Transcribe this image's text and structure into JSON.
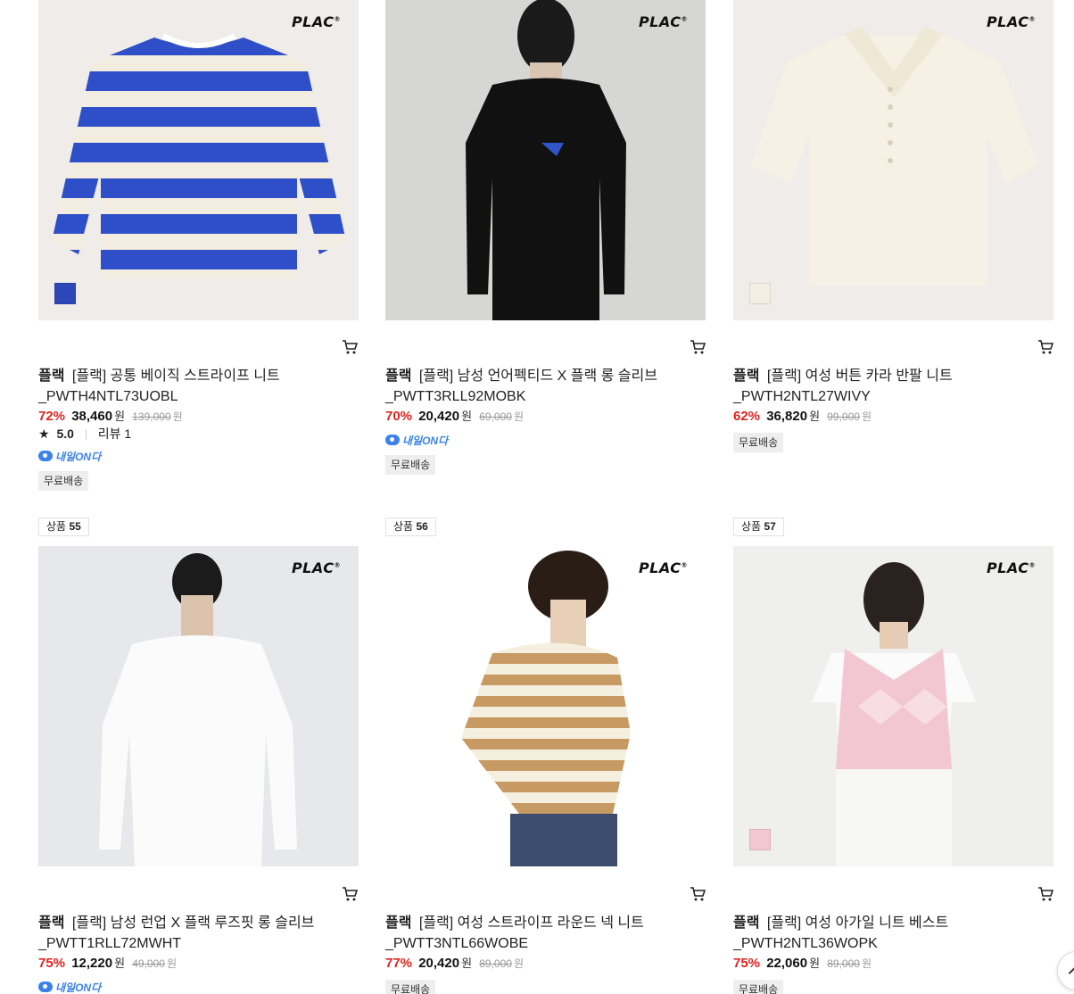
{
  "products": [
    {
      "brand": "플랙",
      "name": "[플랙] 공통 베이직 스트라이프 니트",
      "code": "_PWTH4NTL73UOBL",
      "discount": "72%",
      "price": "38,460",
      "currency": "원",
      "original_price": "139,000",
      "rating": "5.0",
      "reviews": "리뷰 1",
      "tomorrow_label": "내일ON다",
      "tag": "무료배송",
      "logo": "PLAC",
      "swatch_color": "#2d47b8"
    },
    {
      "brand": "플랙",
      "name": "[플랙] 남성 언어펙티드 X 플랙 롱 슬리브",
      "code": "_PWTT3RLL92MOBK",
      "discount": "70%",
      "price": "20,420",
      "currency": "원",
      "original_price": "69,000",
      "tomorrow_label": "내일ON다",
      "tag": "무료배송",
      "logo": "PLAC"
    },
    {
      "brand": "플랙",
      "name": "[플랙] 여성 버튼 카라 반팔 니트",
      "code": "_PWTH2NTL27WIVY",
      "discount": "62%",
      "price": "36,820",
      "currency": "원",
      "original_price": "99,000",
      "tag": "무료배송",
      "logo": "PLAC",
      "swatch_color": "#f3efe3"
    },
    {
      "rank_label": "상품",
      "rank_number": "55",
      "brand": "플랙",
      "name": "[플랙] 남성 런업 X 플랙 루즈핏 롱 슬리브",
      "code": "_PWTT1RLL72MWHT",
      "discount": "75%",
      "price": "12,220",
      "currency": "원",
      "original_price": "49,000",
      "tomorrow_label": "내일ON다",
      "logo": "PLAC"
    },
    {
      "rank_label": "상품",
      "rank_number": "56",
      "brand": "플랙",
      "name": "[플랙] 여성 스트라이프 라운드 넥 니트",
      "code": "_PWTT3NTL66WOBE",
      "discount": "77%",
      "price": "20,420",
      "currency": "원",
      "original_price": "89,000",
      "tag": "무료배송",
      "logo": "PLAC"
    },
    {
      "rank_label": "상품",
      "rank_number": "57",
      "brand": "플랙",
      "name": "[플랙] 여성 아가일 니트 베스트",
      "code": "_PWTH2NTL36WOPK",
      "discount": "75%",
      "price": "22,060",
      "currency": "원",
      "original_price": "89,000",
      "tag": "무료배송",
      "logo": "PLAC",
      "swatch_color": "#f3c6d3"
    }
  ]
}
